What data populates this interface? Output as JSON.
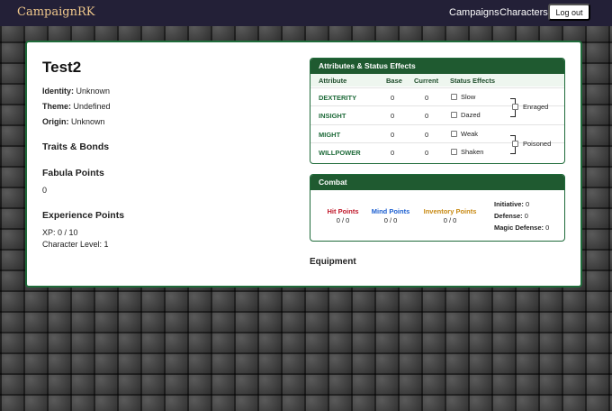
{
  "nav": {
    "brand": "CampaignRK",
    "campaigns": "Campaigns",
    "characters": "Characters",
    "logout": "Log out"
  },
  "character": {
    "name": "Test2",
    "identity_label": "Identity:",
    "identity": "Unknown",
    "theme_label": "Theme:",
    "theme": "Undefined",
    "origin_label": "Origin:",
    "origin": "Unknown",
    "traits_heading": "Traits & Bonds",
    "fabula_heading": "Fabula Points",
    "fabula_value": "0",
    "xp_heading": "Experience Points",
    "xp_line": "XP: 0 / 10",
    "level_line": "Character Level: 1",
    "equipment_heading": "Equipment"
  },
  "attributes": {
    "title": "Attributes & Status Effects",
    "headers": {
      "attribute": "Attribute",
      "base": "Base",
      "current": "Current",
      "status": "Status Effects"
    },
    "rows": [
      {
        "name": "DEXTERITY",
        "base": "0",
        "current": "0",
        "effect": "Slow",
        "checked": false
      },
      {
        "name": "INSIGHT",
        "base": "0",
        "current": "0",
        "effect": "Dazed",
        "checked": false
      },
      {
        "name": "MIGHT",
        "base": "0",
        "current": "0",
        "effect": "Weak",
        "checked": false
      },
      {
        "name": "WILLPOWER",
        "base": "0",
        "current": "0",
        "effect": "Shaken",
        "checked": false
      }
    ],
    "combined": [
      {
        "label": "Enraged",
        "checked": false
      },
      {
        "label": "Poisoned",
        "checked": false
      }
    ]
  },
  "combat": {
    "title": "Combat",
    "hp_label": "Hit Points",
    "hp_value": "0 / 0",
    "mp_label": "Mind Points",
    "mp_value": "0 / 0",
    "ip_label": "Inventory Points",
    "ip_value": "0 / 0",
    "initiative_label": "Initiative:",
    "initiative": "0",
    "defense_label": "Defense:",
    "defense": "0",
    "magic_defense_label": "Magic Defense:",
    "magic_defense": "0"
  },
  "colors": {
    "hp": "#c0182a",
    "mp": "#1c5fd0",
    "ip": "#c88a14",
    "accent": "#1f6b3a",
    "navbar": "#232037",
    "brand": "#f1c98c"
  }
}
